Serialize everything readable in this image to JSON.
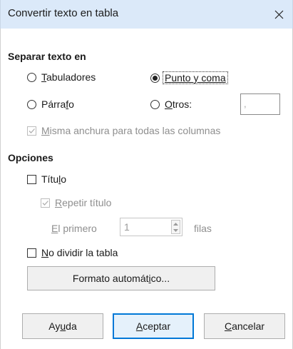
{
  "dialog": {
    "title": "Convertir texto en tabla",
    "close_icon": "close-icon"
  },
  "separator": {
    "heading": "Separar texto en",
    "tabs": {
      "pre": "",
      "key": "T",
      "post": "abuladores",
      "checked": false
    },
    "semicolon": {
      "pre": "",
      "key": "P",
      "post": "unto y coma",
      "checked": true
    },
    "paragraph": {
      "pre": "Párra",
      "key": "f",
      "post": "o",
      "checked": false
    },
    "other": {
      "pre": "",
      "key": "O",
      "post": "tros:",
      "checked": false
    },
    "other_value": ",",
    "equal_width": {
      "pre": "",
      "key": "M",
      "post": "isma anchura para todas las columnas",
      "checked": true,
      "enabled": false
    }
  },
  "options": {
    "heading": "Opciones",
    "heading_title": {
      "pre": "Títu",
      "key": "l",
      "post": "o",
      "checked": false
    },
    "repeat_heading": {
      "pre": "",
      "key": "R",
      "post": "epetir título",
      "checked": true,
      "enabled": false
    },
    "first": {
      "pre": "",
      "key": "E",
      "post": "l primero",
      "value": "1",
      "suffix": "filas"
    },
    "dont_split": {
      "pre": "",
      "key": "N",
      "post": "o dividir la tabla",
      "checked": false
    },
    "autoformat": {
      "pre": "Formato automát",
      "key": "i",
      "post": "co..."
    }
  },
  "buttons": {
    "help": {
      "pre": "Ay",
      "key": "u",
      "post": "da"
    },
    "ok": {
      "pre": "",
      "key": "A",
      "post": "ceptar"
    },
    "cancel": {
      "pre": "",
      "key": "C",
      "post": "ancelar"
    }
  },
  "colors": {
    "titlebar": "#dbe9f9",
    "default_button_border": "#0078d7",
    "disabled_text": "#8e8e8e"
  }
}
